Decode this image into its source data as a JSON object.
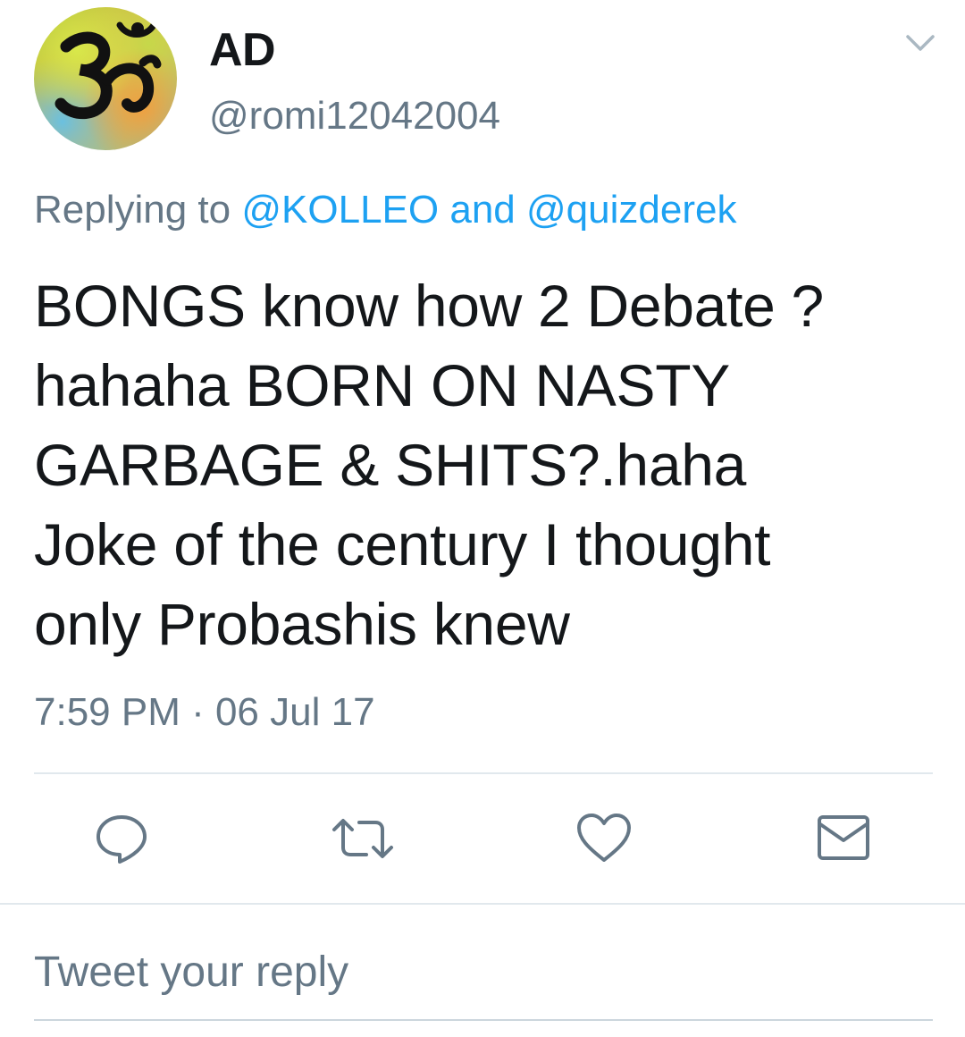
{
  "author": {
    "display_name": "AD",
    "handle": "@romi12042004",
    "avatar_icon": "om-symbol-icon"
  },
  "reply_context": {
    "prefix": "Replying to ",
    "mention_1": "@KOLLEO",
    "conjunction": " and ",
    "mention_2": "@quizderek"
  },
  "tweet": {
    "text_line_1": "BONGS know how 2 Debate ?",
    "text_line_2": "hahaha BORN ON NASTY",
    "text_line_3": "GARBAGE & SHITS?.haha",
    "text_line_4": "Joke of the century I thought",
    "text_line_5": "only Probashis knew",
    "timestamp": "7:59 PM · 06 Jul 17"
  },
  "actions": {
    "reply_icon": "reply-bubble-icon",
    "retweet_icon": "retweet-icon",
    "like_icon": "heart-icon",
    "dm_icon": "envelope-icon"
  },
  "composer": {
    "placeholder": "Tweet your reply"
  },
  "colors": {
    "text": "#14171a",
    "secondary": "#657786",
    "link": "#1da1f2",
    "divider": "#e1e8ed"
  }
}
